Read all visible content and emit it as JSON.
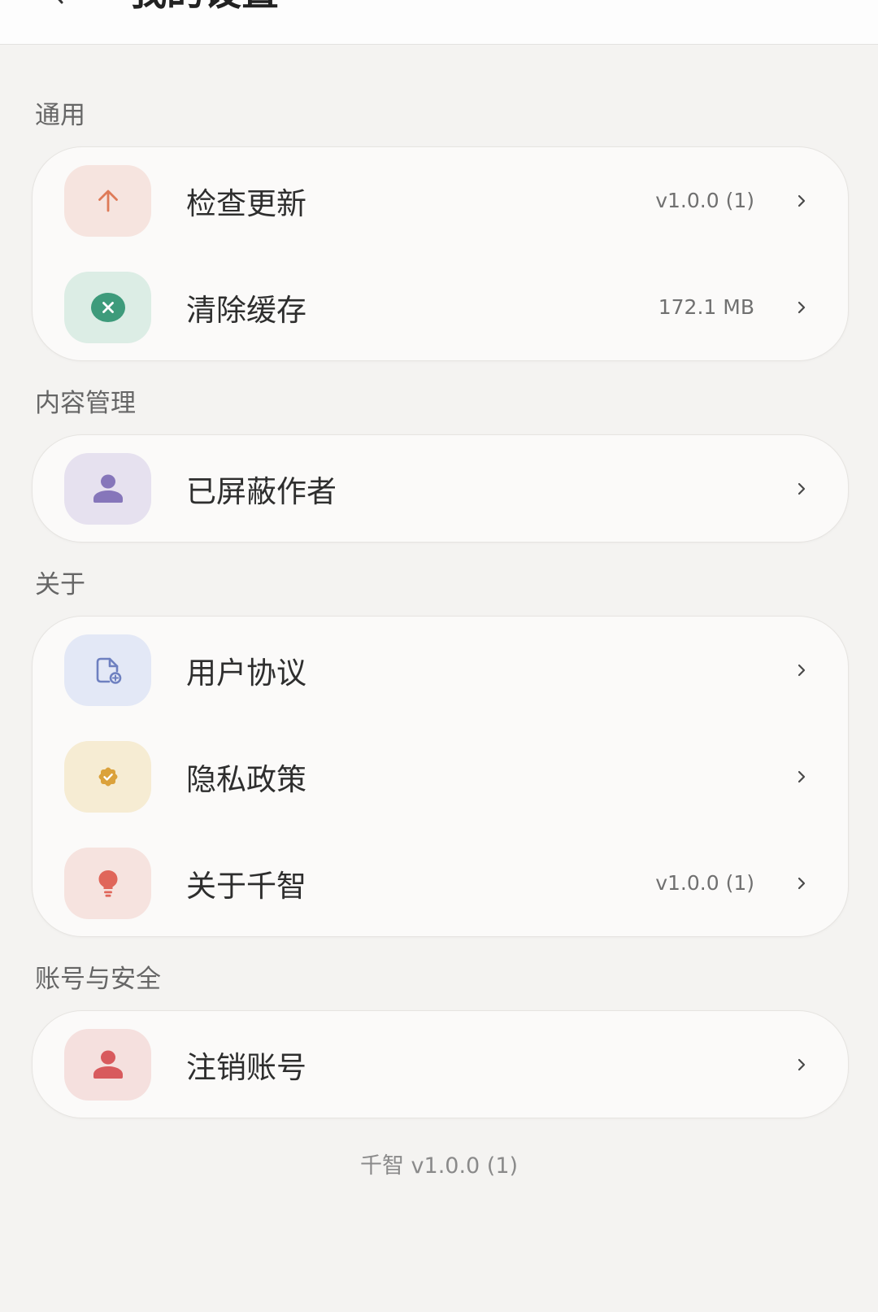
{
  "header": {
    "title": "我的设置",
    "back_icon": "chevron-left-icon"
  },
  "theme": {
    "page_background": "#f4f3f1",
    "card_background": "#fbfaf9",
    "header_background": "#fdfdfd"
  },
  "sections": [
    {
      "label": "通用",
      "items": [
        {
          "label": "检查更新",
          "value": "v1.0.0 (1)",
          "icon": "arrow-up-icon",
          "icon_color": "#de7a57",
          "icon_bg": "#f6e4df"
        },
        {
          "label": "清除缓存",
          "value": "172.1 MB",
          "icon": "clear-circle-icon",
          "icon_color": "#3e9b7b",
          "icon_bg": "#dcede5"
        }
      ]
    },
    {
      "label": "内容管理",
      "items": [
        {
          "label": "已屏蔽作者",
          "icon": "person-icon",
          "icon_color": "#8676ba",
          "icon_bg": "#e6e1ef"
        }
      ]
    },
    {
      "label": "关于",
      "items": [
        {
          "label": "用户协议",
          "icon": "document-icon",
          "icon_color": "#6e80c0",
          "icon_bg": "#e3e8f6"
        },
        {
          "label": "隐私政策",
          "icon": "verified-badge-icon",
          "icon_color": "#dba23c",
          "icon_bg": "#f6ecd3"
        },
        {
          "label": "关于千智",
          "value": "v1.0.0 (1)",
          "icon": "lightbulb-icon",
          "icon_color": "#e0665a",
          "icon_bg": "#f6e3df"
        }
      ]
    },
    {
      "label": "账号与安全",
      "items": [
        {
          "label": "注销账号",
          "icon": "person-icon",
          "icon_color": "#d85a5d",
          "icon_bg": "#f5e0de"
        }
      ]
    }
  ],
  "chevron_icon": "chevron-right-icon",
  "footer": {
    "version_text": "千智 v1.0.0 (1)"
  }
}
